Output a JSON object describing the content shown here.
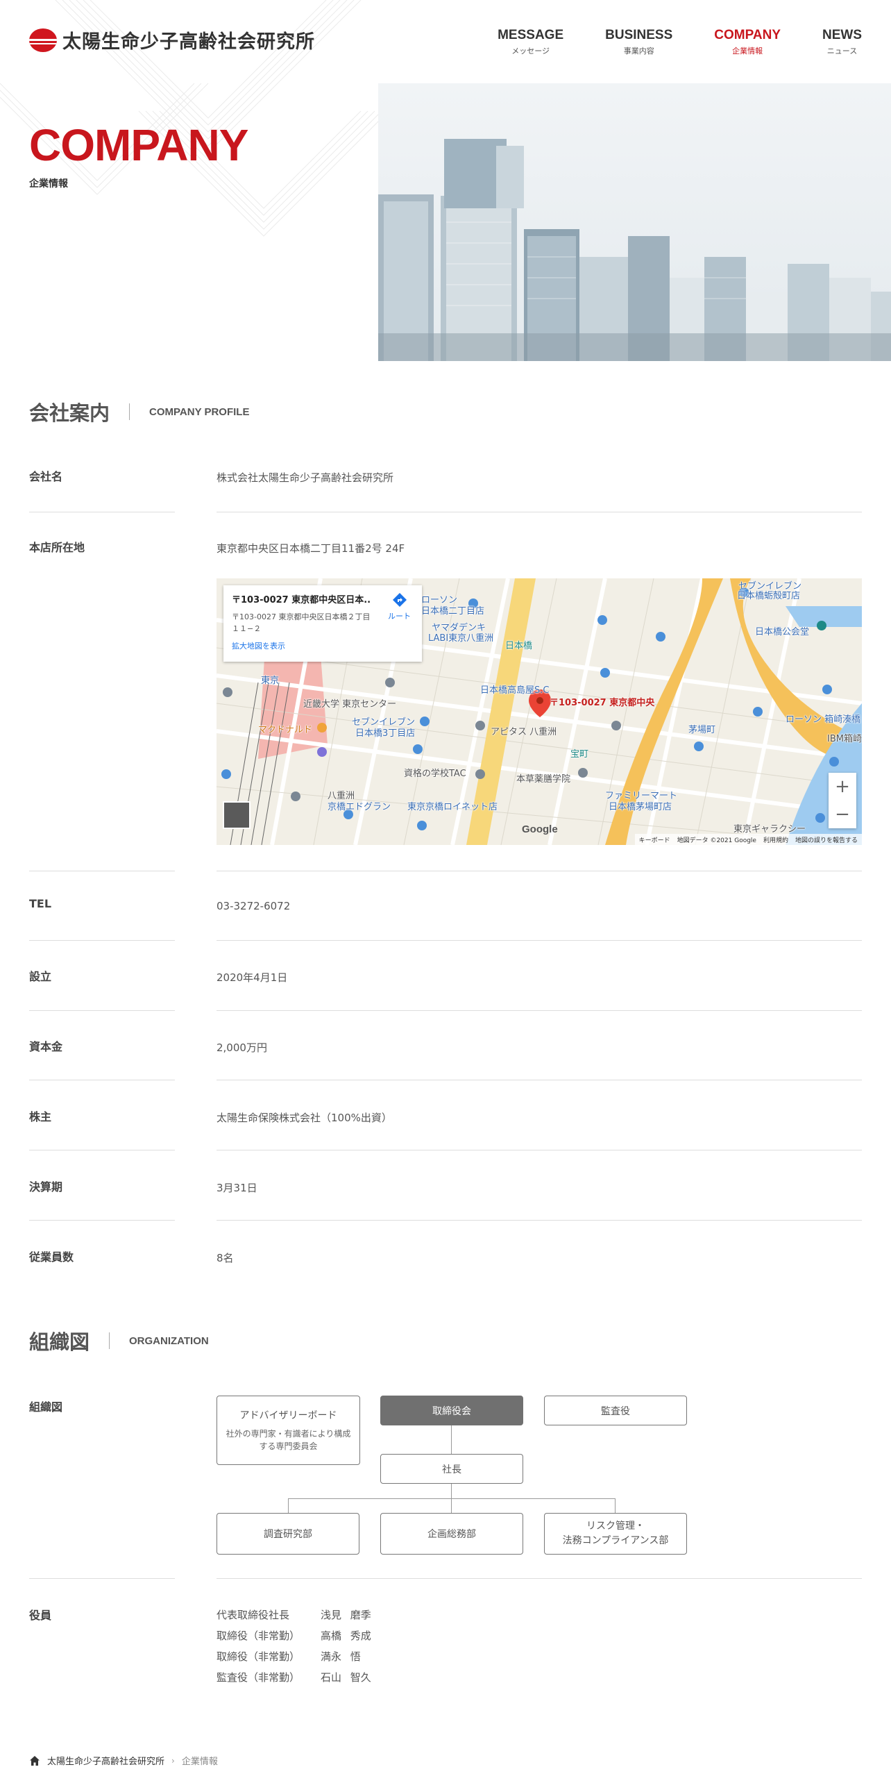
{
  "header": {
    "logo_text": "太陽生命少子高齢社会研究所",
    "nav": [
      {
        "en": "MESSAGE",
        "ja": "メッセージ"
      },
      {
        "en": "BUSINESS",
        "ja": "事業内容"
      },
      {
        "en": "COMPANY",
        "ja": "企業情報"
      },
      {
        "en": "NEWS",
        "ja": "ニュース"
      }
    ]
  },
  "hero": {
    "title": "COMPANY",
    "subtitle": "企業情報"
  },
  "profile": {
    "heading_ja": "会社案内",
    "heading_en": "COMPANY PROFILE",
    "rows": {
      "name": {
        "label": "会社名",
        "value": "株式会社太陽生命少子高齢社会研究所"
      },
      "address": {
        "label": "本店所在地",
        "value": "東京都中央区日本橋二丁目11番2号 24F"
      },
      "tel": {
        "label": "TEL",
        "value": "03-3272-6072"
      },
      "founded": {
        "label": "設立",
        "value": "2020年4月1日"
      },
      "capital": {
        "label": "資本金",
        "value": "2,000万円"
      },
      "shareholder": {
        "label": "株主",
        "value": "太陽生命保険株式会社（100%出資）"
      },
      "fiscal": {
        "label": "決算期",
        "value": "3月31日"
      },
      "employees": {
        "label": "従業員数",
        "value": "8名"
      }
    }
  },
  "map": {
    "card_title": "〒103-0027 東京都中央区日本...",
    "card_address": "〒103-0027 東京都中央区日本橋２丁目１１−２",
    "card_link": "拡大地図を表示",
    "route_label": "ルート",
    "pin_label": "〒103-0027 東京都中央",
    "google": "Google",
    "footer": [
      "キーボード",
      "地図データ ©2021 Google",
      "利用規約",
      "地図の誤りを報告する"
    ],
    "labels": {
      "l1": "ローソン",
      "l2": "日本橋二丁目店",
      "l3": "ヤマダデンキ",
      "l4": "LABI東京八重洲",
      "l5": "日本橋高島屋S.C",
      "l6": "東京",
      "l7": "近畿大学 東京センター",
      "l8": "セブンイレブン",
      "l9": "日本橋3丁目店",
      "l10": "アピタス 八重洲",
      "l11": "資格の学校TAC",
      "l12": "本草薬膳学院",
      "l13": "ファミリーマート",
      "l14": "日本橋茅場町店",
      "l15": "茅場町",
      "l16": "日本橋公会堂",
      "l17": "セブンイレブン",
      "l18": "日本橋蛎殻町店",
      "l19": "マクドナルド",
      "l20": "八重洲",
      "l21": "京橋エドグラン",
      "l22": "東京京橋ロイネット店",
      "l23": "ローソン 箱崎湊橋",
      "l24": "IBM箱崎",
      "l25": "東京ギャラクシー",
      "l26": "日本橋",
      "l27": "宝町"
    },
    "zoom_in": "+",
    "zoom_out": "−"
  },
  "organization": {
    "heading_ja": "組織図",
    "heading_en": "ORGANIZATION",
    "row_label": "組織図",
    "advisory": "アドバイザリーボード",
    "advisory_sub": "社外の専門家・有識者により構成する専門委員会",
    "board": "取締役会",
    "auditor": "監査役",
    "president": "社長",
    "dept1": "調査研究部",
    "dept2": "企画総務部",
    "dept3_line1": "リスク管理・",
    "dept3_line2": "法務コンプライアンス部"
  },
  "officers": {
    "label": "役員",
    "list": [
      {
        "role": "代表取締役社長",
        "name": "浅見 磨季"
      },
      {
        "role": "取締役（非常勤）",
        "name": "高橋 秀成"
      },
      {
        "role": "取締役（非常勤）",
        "name": "満永 悟"
      },
      {
        "role": "監査役（非常勤）",
        "name": "石山 智久"
      }
    ]
  },
  "breadcrumb": {
    "home": "太陽生命少子高齢社会研究所",
    "current": "企業情報"
  },
  "colors": {
    "accent": "#c8161d",
    "dark_box": "#707070"
  }
}
